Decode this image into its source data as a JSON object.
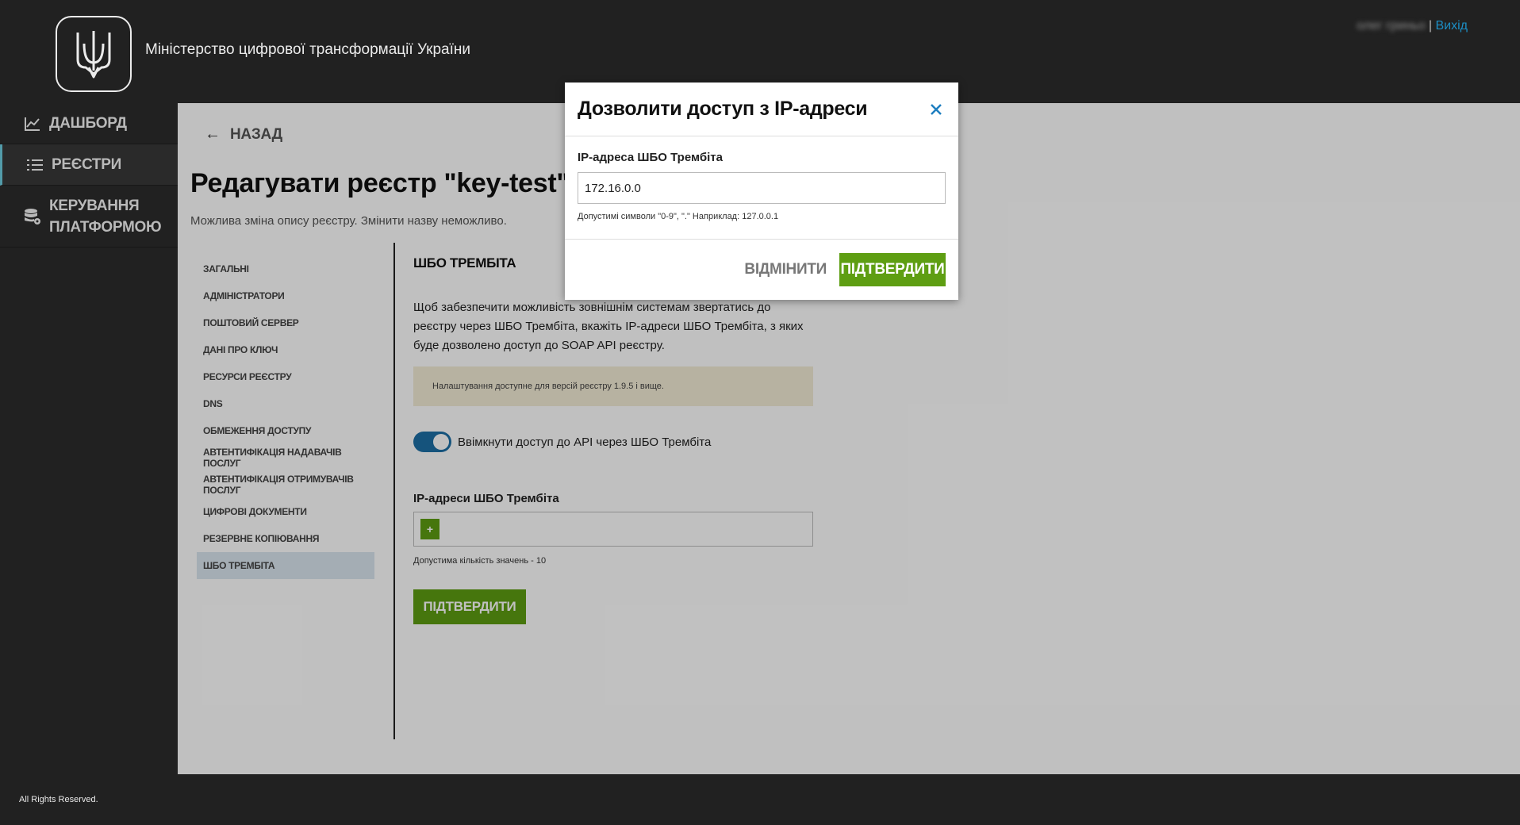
{
  "header": {
    "org_name": "Міністерство цифрової трансформації України",
    "user_name": "олег гриньо",
    "separator": "|",
    "logout": "Вихід"
  },
  "sidebar": {
    "items": [
      {
        "label": "Дашборд",
        "icon": "chart-icon"
      },
      {
        "label": "Реєстри",
        "icon": "list-icon"
      },
      {
        "label": "Керування платформою",
        "icon": "database-gear-icon"
      }
    ]
  },
  "main": {
    "back": "Назад",
    "title": "Редагувати реєстр \"key-test\"",
    "subtitle": "Можлива зміна опису реєстру. Змінити назву неможливо.",
    "subnav": [
      "Загальні",
      "Адміністратори",
      "Поштовий сервер",
      "Дані про ключ",
      "Ресурси реєстру",
      "DNS",
      "Обмеження доступу",
      "Автентифікація надавачів послуг",
      "Автентифікація отримувачів послуг",
      "Цифрові документи",
      "Резервне копіювання",
      "ШБО Трембіта"
    ],
    "section": {
      "title": "ШБО Трембіта",
      "description": "Щоб забезпечити можливість зовнішнім системам звертатись до реєстру через ШБО Трембіта, вкажіть IP-адреси ШБО Трембіта, з яких буде дозволено доступ до SOAP API реєстру.",
      "notice": "Налаштування доступне для версій реєстру 1.9.5 і вище.",
      "toggle_label": "Ввімкнути доступ до API через ШБО Трембіта",
      "toggle_on": true,
      "ip_label": "IP-адреси ШБО Трембіта",
      "add_symbol": "+",
      "ip_hint": "Допустима кількість значень - 10",
      "confirm": "Підтвердити"
    }
  },
  "footer": {
    "text": "All Rights Reserved."
  },
  "modal": {
    "title": "Дозволити доступ з IP-адреси",
    "field_label": "IP-адреса ШБО Трембіта",
    "field_value": "172.16.0.0",
    "field_hint": "Допустимі символи \"0-9\", \".\" Наприклад: 127.0.0.1",
    "cancel": "Відмінити",
    "confirm": "Підтвердити"
  },
  "colors": {
    "accent_green": "#5e9e12",
    "link_blue": "#1f9bd6",
    "toggle_blue": "#1d6fa5",
    "notice_bg": "#f4ecd6"
  }
}
